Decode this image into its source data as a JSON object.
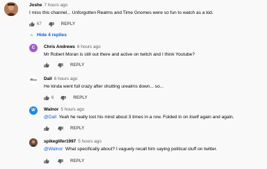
{
  "comments": [
    {
      "author": "Joshe",
      "time": "7 hours ago",
      "text": "I miss this channel... Unforgotten Realms and Time Gnomes were so fun to watch as a kid.",
      "likes": "67",
      "reply_label": "REPLY",
      "avatar_color": "#8a5a44"
    }
  ],
  "hide_replies_label": "Hide 4 replies",
  "replies": [
    {
      "author": "Chris Andrews",
      "time": "6 hours ago",
      "text": "Mr Robert Moran is still out there and active on twitch and I think Youtube?",
      "likes": "",
      "reply_label": "REPLY",
      "avatar_letter": "C",
      "avatar_color": "#9c5fc7"
    },
    {
      "author": "Dall",
      "time": "6 hours ago",
      "text": "He kinda went full crazy after shutting urealms down... so...",
      "likes": "6",
      "reply_label": "REPLY",
      "avatar_color": "#ffffff"
    },
    {
      "author": "Walnor",
      "time": "5 hours ago",
      "mention": "@Dall",
      "text": "  Yeah he really lost his mind about 3 times in a row. Folded in on itself again and again.",
      "likes": "",
      "reply_label": "REPLY",
      "avatar_letter": "W",
      "avatar_color": "#1e88e5"
    },
    {
      "author": "spikeglifer1997",
      "time": "5 hours ago",
      "mention": "@Walnor",
      "text": "  What specifically about? I vaguely recall him saying political stuff on twitter.",
      "likes": "",
      "reply_label": "REPLY",
      "avatar_color": "#5d4037"
    }
  ]
}
